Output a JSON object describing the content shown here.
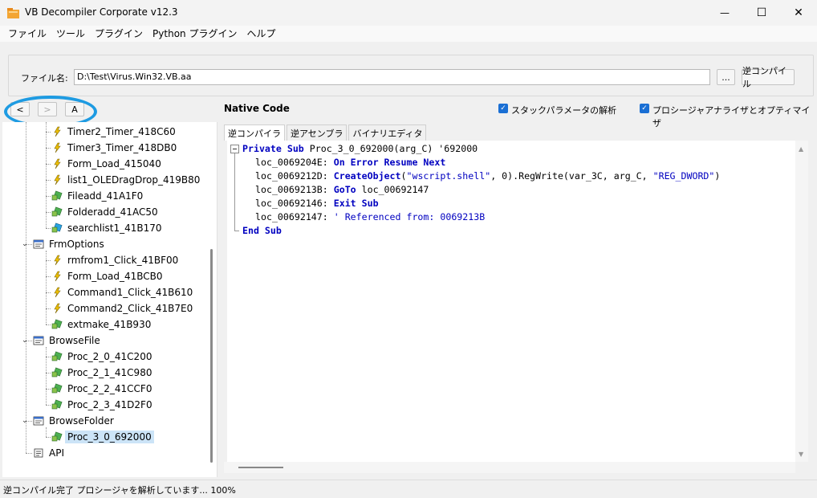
{
  "window": {
    "title": "VB Decompiler Corporate v12.3",
    "minimize_glyph": "—",
    "maximize_glyph": "☐",
    "close_glyph": "✕"
  },
  "menu": [
    "ファイル",
    "ツール",
    "プラグイン",
    "Python プラグイン",
    "ヘルプ"
  ],
  "file_row": {
    "label": "ファイル名:",
    "value": "D:\\Test\\Virus.Win32.VB.aa",
    "browse_label": "...",
    "decompile_label": "逆コンパイル"
  },
  "nav": {
    "back": "<",
    "forward": ">",
    "a": "A"
  },
  "native_code_label": "Native Code",
  "options": {
    "stack_params": "スタックパラメータの解析",
    "procedure_analyzer": "プロシージャアナライザとオプティマイザ"
  },
  "tree": {
    "items": [
      {
        "label": "Timer2_Timer_418C60",
        "icon": "event-icon"
      },
      {
        "label": "Timer3_Timer_418DB0",
        "icon": "event-icon"
      },
      {
        "label": "Form_Load_415040",
        "icon": "event-icon"
      },
      {
        "label": "list1_OLEDragDrop_419B80",
        "icon": "event-icon"
      },
      {
        "label": "Fileadd_41A1F0",
        "icon": "proc-icon"
      },
      {
        "label": "Folderadd_41AC50",
        "icon": "proc-icon"
      },
      {
        "label": "searchlist1_41B170",
        "icon": "proc-blue-icon"
      },
      {
        "label": "FrmOptions",
        "icon": "form-icon"
      },
      {
        "label": "rmfrom1_Click_41BF00",
        "icon": "event-icon"
      },
      {
        "label": "Form_Load_41BCB0",
        "icon": "event-icon"
      },
      {
        "label": "Command1_Click_41B610",
        "icon": "event-icon"
      },
      {
        "label": "Command2_Click_41B7E0",
        "icon": "event-icon"
      },
      {
        "label": "extmake_41B930",
        "icon": "proc-icon"
      },
      {
        "label": "BrowseFile",
        "icon": "form-icon"
      },
      {
        "label": "Proc_2_0_41C200",
        "icon": "proc-icon"
      },
      {
        "label": "Proc_2_1_41C980",
        "icon": "proc-icon"
      },
      {
        "label": "Proc_2_2_41CCF0",
        "icon": "proc-icon"
      },
      {
        "label": "Proc_2_3_41D2F0",
        "icon": "proc-icon"
      },
      {
        "label": "BrowseFolder",
        "icon": "form-icon"
      },
      {
        "label": "Proc_3_0_692000",
        "icon": "proc-icon"
      },
      {
        "label": "API",
        "icon": "api-icon"
      }
    ]
  },
  "tabs": [
    "逆コンパイラ",
    "逆アセンブラ",
    "バイナリエディタ"
  ],
  "code": {
    "l1a": "Private Sub",
    "l1b": " Proc_3_0_692000(arg_C) '692000",
    "l2a": "loc_0069204E: ",
    "l2b": "On Error Resume Next",
    "l3a": "loc_0069212D: ",
    "l3b": "CreateObject",
    "l3c": "(",
    "l3d": "\"wscript.shell\"",
    "l3e": ", 0).RegWrite(var_3C, arg_C, ",
    "l3f": "\"REG_DWORD\"",
    "l3g": ")",
    "l4a": "loc_0069213B: ",
    "l4b": "GoTo",
    "l4c": " loc_00692147",
    "l5a": "loc_00692146: ",
    "l5b": "Exit Sub",
    "l6a": "loc_00692147: ",
    "l6b": "' Referenced from: 0069213B",
    "l7": "End Sub"
  },
  "status": "逆コンパイル完了 プロシージャを解析しています... 100%"
}
